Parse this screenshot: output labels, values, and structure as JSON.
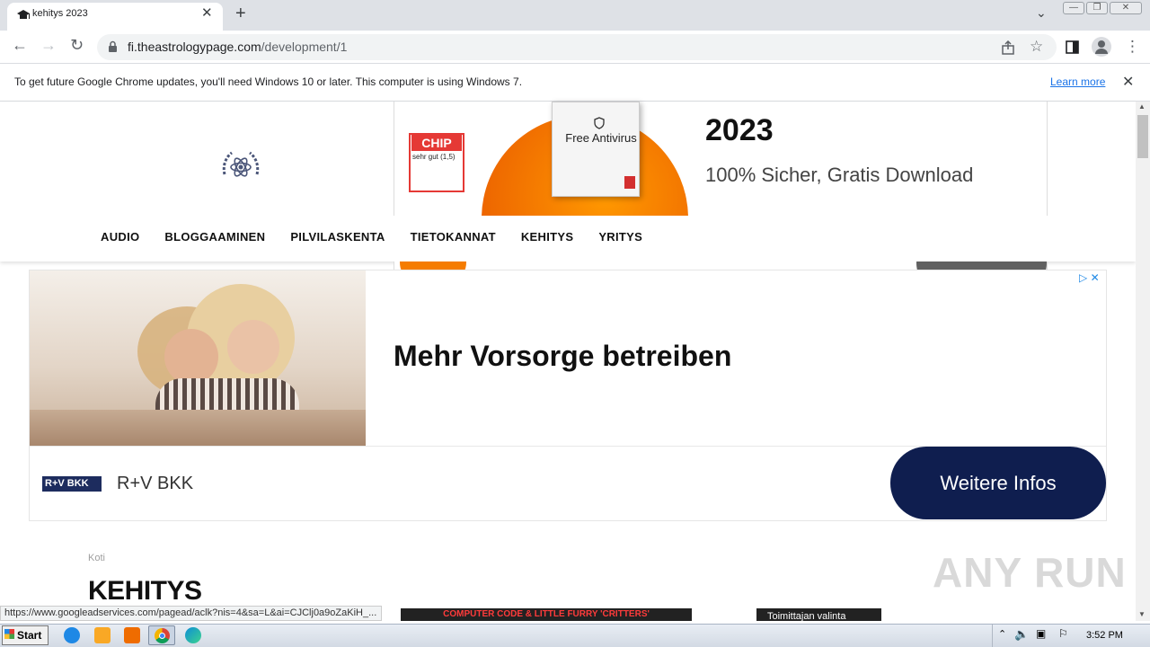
{
  "browser": {
    "tab_title": "kehitys 2023",
    "url_host": "fi.theastrologypage.com",
    "url_path": "/development/1",
    "info_message": "To get future Google Chrome updates, you'll need Windows 10 or later. This computer is using Windows 7.",
    "info_link": "Learn more",
    "status_url": "https://www.googleadservices.com/pagead/aclk?nis=4&sa=L&ai=CJClj0a9oZaKiH_..."
  },
  "top_ad": {
    "badge_logo": "CHIP",
    "badge_grade": "sehr gut (1,5)",
    "box_label": "Free Antivirus",
    "year": "2023",
    "subtitle": "100% Sicher, Gratis Download"
  },
  "nav": {
    "items": [
      "AUDIO",
      "BLOGGAAMINEN",
      "PILVILASKENTA",
      "TIETOKANNAT",
      "KEHITYS",
      "YRITYS"
    ]
  },
  "main_ad": {
    "headline": "Mehr Vorsorge betreiben",
    "logo_text": "R+V BKK",
    "advertiser": "R+V BKK",
    "cta": "Weitere Infos"
  },
  "content": {
    "breadcrumb": "Koti",
    "title": "KEHITYS",
    "thumb_caption": "COMPUTER CODE & LITTLE FURRY 'CRITTERS'",
    "editor_pick": "Toimittajan valinta"
  },
  "watermark": "ANY RUN",
  "taskbar": {
    "start_label": "Start",
    "clock": "3:52 PM"
  }
}
